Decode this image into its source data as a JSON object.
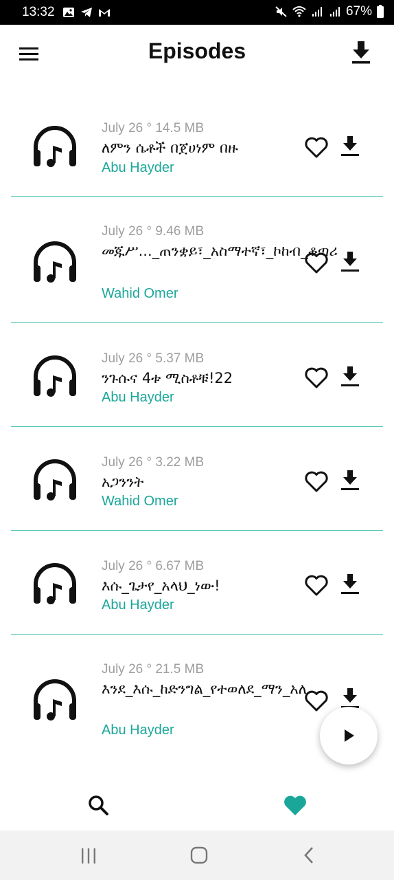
{
  "status_bar": {
    "time": "13:32",
    "battery": "67%",
    "left_icons": [
      "gallery-icon",
      "telegram-icon",
      "gmail-icon"
    ],
    "right_icons": [
      "mute-icon",
      "wifi-icon",
      "signal-icon",
      "signal-icon",
      "battery-icon"
    ]
  },
  "app_bar": {
    "title": "Episodes",
    "menu_icon": "hamburger-menu-icon",
    "action_icon": "download-icon"
  },
  "colors": {
    "accent": "#1aa79a",
    "divider": "#56c7b8",
    "meta_text": "#9e9e9e"
  },
  "episodes": [
    {
      "meta": "July 26 ° 14.5 MB",
      "title": "ለምን ሴቶች በጀሀነም በዙ",
      "author": "Abu Hayder"
    },
    {
      "meta": "July 26 ° 9.46 MB",
      "title": "መጁሥ..._ጠንቋይ፣_አስማተኛ፣_ኮከብ_ቆጣሪ",
      "author": "Wahid Omer"
    },
    {
      "meta": "July 26 ° 5.37 MB",
      "title": "ንጉሱና 4ቱ ሚስቶቹ!22",
      "author": "Abu Hayder"
    },
    {
      "meta": "July 26 ° 3.22 MB",
      "title": "አጋንንት",
      "author": "Wahid Omer"
    },
    {
      "meta": "July 26 ° 6.67 MB",
      "title": "እሱ_ጌታየ_አላህ_ነው!",
      "author": "Abu Hayder"
    },
    {
      "meta": "July 26 ° 21.5 MB",
      "title": "እንደ_እሱ_ከድንግል_የተወለደ_ማን_አለ",
      "author": "Abu Hayder"
    }
  ],
  "bottom_nav": {
    "items": [
      {
        "icon": "search-icon",
        "active": false
      },
      {
        "icon": "heart-icon",
        "active": true
      }
    ]
  },
  "system_nav": [
    "recents-icon",
    "home-icon",
    "back-icon"
  ]
}
